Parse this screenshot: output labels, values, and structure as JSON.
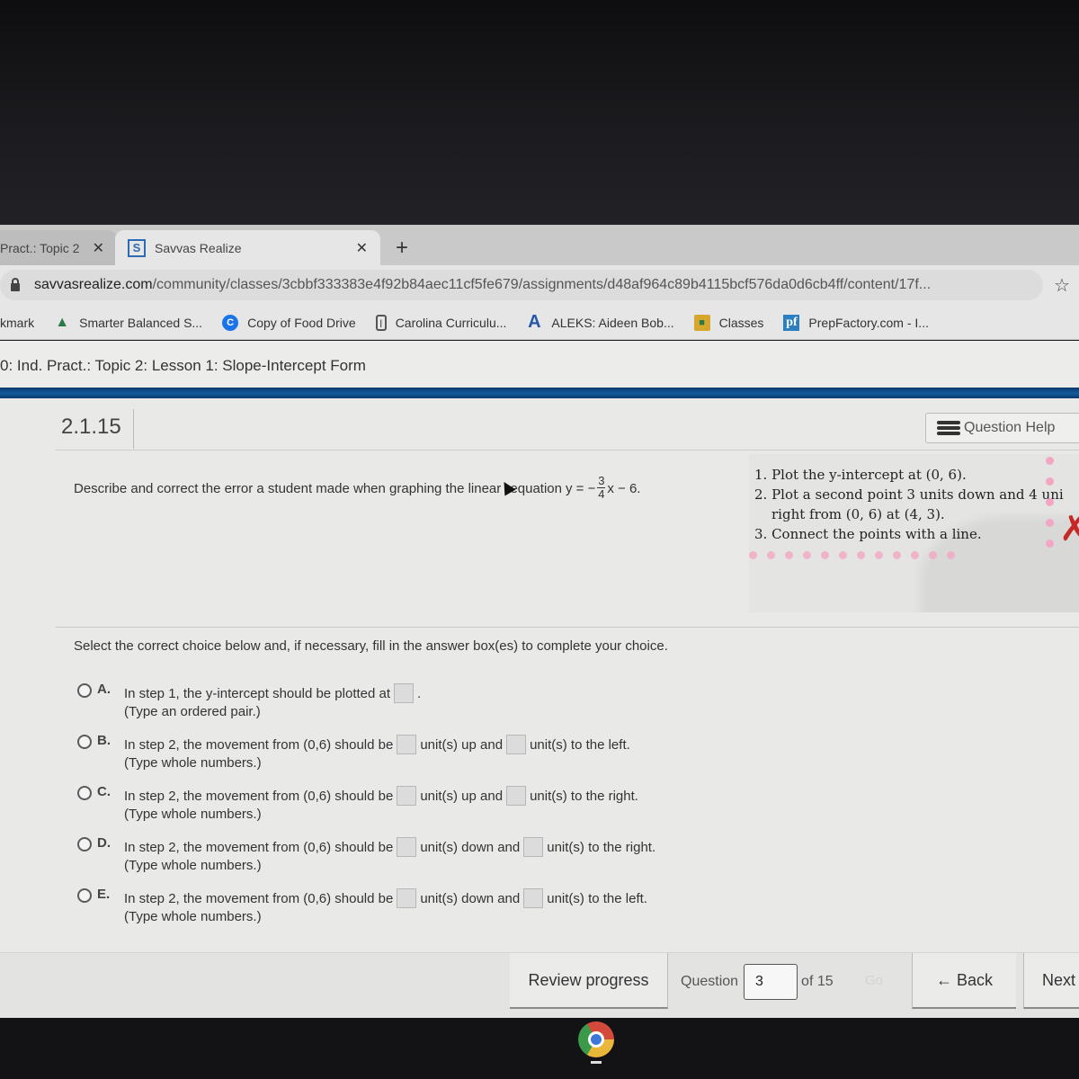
{
  "browser": {
    "tabs": [
      {
        "title": "Pract.: Topic 2",
        "active": false
      },
      {
        "title": "Savvas Realize",
        "active": true,
        "favicon": "savvas-s-icon"
      }
    ],
    "url_domain": "savvasrealize.com",
    "url_path": "/community/classes/3cbbf333383e4f92b84aec11cf5fe679/assignments/d48af964c89b4115bcf576da0d6cb4ff/content/17f...",
    "bookmarks": [
      {
        "label": "kmark",
        "icon": ""
      },
      {
        "label": "Smarter Balanced S...",
        "icon": "tree-icon"
      },
      {
        "label": "Copy of Food Drive",
        "icon": "c-circle-icon"
      },
      {
        "label": "Carolina Curriculu...",
        "icon": "battery-icon"
      },
      {
        "label": "ALEKS: Aideen Bob...",
        "icon": "aleks-a-icon"
      },
      {
        "label": "Classes",
        "icon": "classroom-icon"
      },
      {
        "label": "PrepFactory.com - I...",
        "icon": "pf-icon"
      }
    ]
  },
  "page": {
    "course_title": "0: Ind. Pract.: Topic 2: Lesson 1: Slope-Intercept Form",
    "question_number": "2.1.15",
    "question_help_label": "Question Help",
    "question_text_before": "Describe and correct the error a student made when graphing the linear ",
    "question_text_cursor_word": "equation",
    "question_eq_prefix": "y = −",
    "question_frac_num": "3",
    "question_frac_den": "4",
    "question_eq_suffix": "x − 6.",
    "student_work": {
      "steps": [
        "1. Plot the y-intercept at (0, 6).",
        "2. Plot a second point 3 units down and 4 uni",
        "right from (0, 6) at (4, 3).",
        "3. Connect the points with a line."
      ],
      "mark": "✗"
    },
    "instructions": "Select the correct choice below and, if necessary, fill in the answer box(es) to complete your choice.",
    "choices": [
      {
        "letter": "A.",
        "text1": "In step 1, the y-intercept should be plotted at",
        "text2": ".",
        "text3": "",
        "hint": "(Type an ordered pair.)"
      },
      {
        "letter": "B.",
        "text1": "In step 2, the movement from (0,6) should be",
        "text2": "unit(s) up and",
        "text3": "unit(s) to the left.",
        "hint": "(Type whole numbers.)"
      },
      {
        "letter": "C.",
        "text1": "In step 2, the movement from (0,6) should be",
        "text2": "unit(s) up and",
        "text3": "unit(s) to the right.",
        "hint": "(Type whole numbers.)"
      },
      {
        "letter": "D.",
        "text1": "In step 2, the movement from (0,6) should be",
        "text2": "unit(s) down and",
        "text3": "unit(s) to the right.",
        "hint": "(Type whole numbers.)"
      },
      {
        "letter": "E.",
        "text1": "In step 2, the movement from (0,6) should be",
        "text2": "unit(s) down and",
        "text3": "unit(s) to the left.",
        "hint": "(Type whole numbers.)"
      }
    ]
  },
  "footer": {
    "review_label": "Review progress",
    "question_label": "Question",
    "question_value": "3",
    "of_total": "of 15",
    "go_label": "Go",
    "back_label": "← Back",
    "next_label": "Next"
  },
  "colors": {
    "accent_blue": "#145a9c",
    "error_red": "#c62828"
  }
}
